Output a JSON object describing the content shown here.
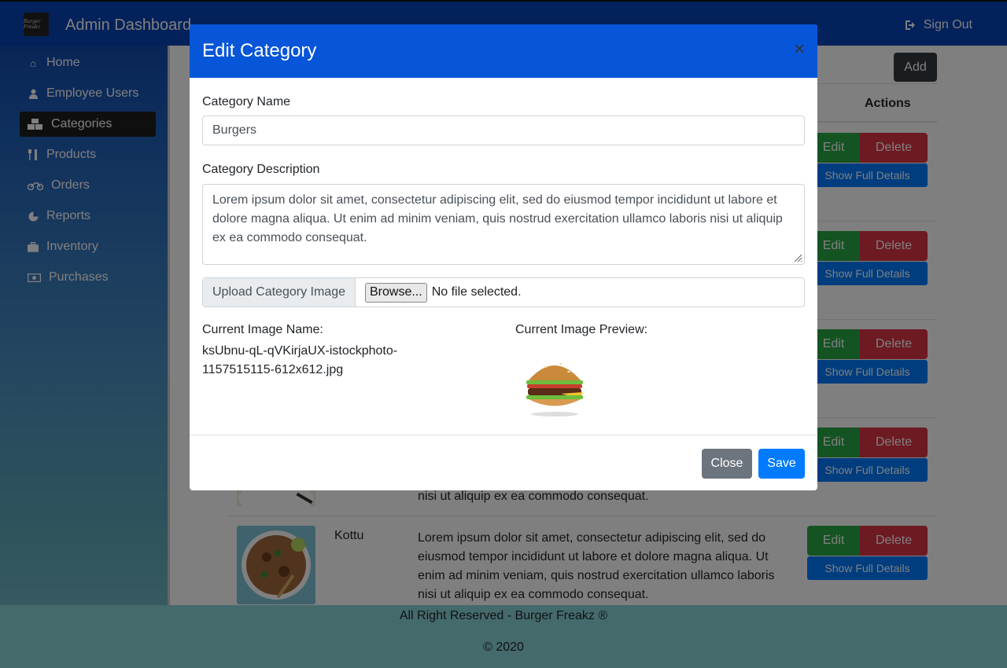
{
  "navbar": {
    "brand_logo_text": "Burger Freakz",
    "title": "Admin Dashboard",
    "signout_label": "Sign Out"
  },
  "sidebar": {
    "items": [
      {
        "label": "Home",
        "icon": "home-icon"
      },
      {
        "label": "Employee Users",
        "icon": "user-icon"
      },
      {
        "label": "Categories",
        "icon": "cubes-icon",
        "active": true
      },
      {
        "label": "Products",
        "icon": "utensils-icon"
      },
      {
        "label": "Orders",
        "icon": "motorcycle-icon"
      },
      {
        "label": "Reports",
        "icon": "pie-chart-icon"
      },
      {
        "label": "Inventory",
        "icon": "briefcase-icon"
      },
      {
        "label": "Purchases",
        "icon": "money-icon"
      }
    ]
  },
  "main": {
    "add_label": "Add",
    "actions_header": "Actions",
    "rows": [
      {
        "edit": "Edit",
        "delete": "Delete",
        "details": "Show Full Details"
      },
      {
        "edit": "Edit",
        "delete": "Delete",
        "details": "Show Full Details"
      },
      {
        "edit": "Edit",
        "delete": "Delete",
        "details": "Show Full Details"
      },
      {
        "edit": "Edit",
        "delete": "Delete",
        "details": "Show Full Details",
        "desc_tail": "nisi ut aliquip ex ea commodo consequat."
      },
      {
        "name": "Kottu",
        "desc": "Lorem ipsum dolor sit amet, consectetur adipiscing elit, sed do eiusmod tempor incididunt ut labore et dolore magna aliqua. Ut enim ad minim veniam, quis nostrud exercitation ullamco laboris nisi ut aliquip ex ea commodo consequat.",
        "edit": "Edit",
        "delete": "Delete",
        "details": "Show Full Details"
      }
    ]
  },
  "footer": {
    "line1": "All Right Reserved - Burger Freakz ®",
    "line2": "© 2020"
  },
  "modal": {
    "title": "Edit Category",
    "close_x": "×",
    "name_label": "Category Name",
    "name_value": "Burgers",
    "desc_label": "Category Description",
    "desc_value": "Lorem ipsum dolor sit amet, consectetur adipiscing elit, sed do eiusmod tempor incididunt ut labore et dolore magna aliqua. Ut enim ad minim veniam, quis nostrud exercitation ullamco laboris nisi ut aliquip ex ea commodo consequat.",
    "upload_label": "Upload Category Image",
    "browse_label": "Browse...",
    "no_file": "No file selected.",
    "current_name_label": "Current Image Name:",
    "current_name_value": "ksUbnu-qL-qVKirjaUX-istockphoto-1157515115-612x612.jpg",
    "current_preview_label": "Current Image Preview:",
    "close_label": "Close",
    "save_label": "Save"
  },
  "colors": {
    "navbar": "#0743b5",
    "modal_header": "#0755d8",
    "edit": "#28a745",
    "delete": "#dc3545",
    "primary": "#007bff",
    "secondary": "#6c757d",
    "dark": "#343a40"
  }
}
